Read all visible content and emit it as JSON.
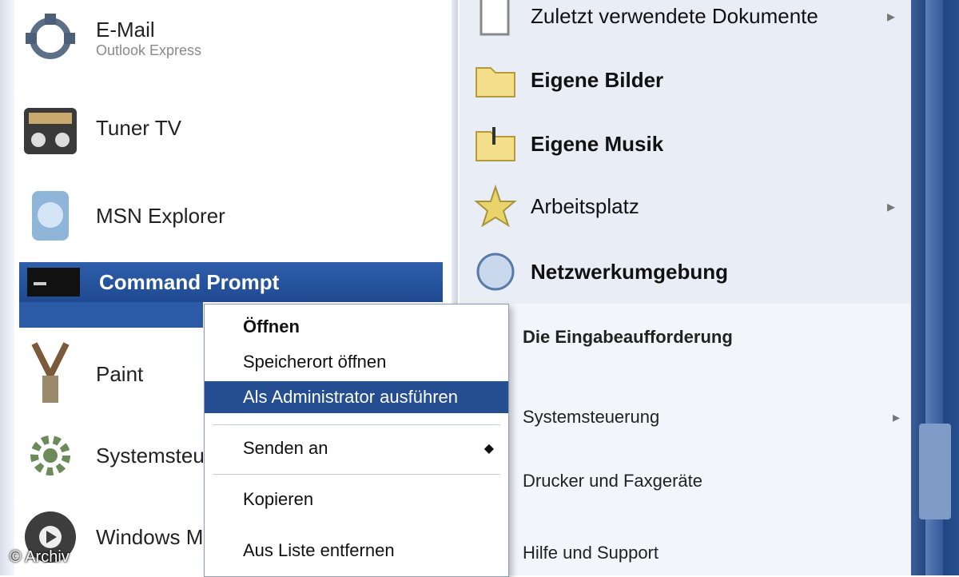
{
  "left_menu": {
    "items": [
      {
        "label": "E-Mail",
        "sub": "Outlook Express"
      },
      {
        "label": "Tuner TV"
      },
      {
        "label": "MSN Explorer"
      },
      {
        "label": "Command Prompt"
      },
      {
        "label": "Paint"
      },
      {
        "label": "Systemsteuerung"
      },
      {
        "label": "Windows Media"
      }
    ]
  },
  "right_menu": {
    "items": [
      {
        "label": "Zuletzt verwendete Dokumente"
      },
      {
        "label": "Eigene Bilder"
      },
      {
        "label": "Eigene Musik"
      },
      {
        "label": "Arbeitsplatz"
      },
      {
        "label": "Netzwerkumgebung"
      }
    ]
  },
  "context_menu": {
    "items": [
      {
        "label": "Öffnen"
      },
      {
        "label": "Speicherort öffnen"
      },
      {
        "label": "Als Administrator ausführen"
      },
      {
        "label": "Senden an"
      },
      {
        "label": "Kopieren"
      },
      {
        "label": "Aus Liste entfernen"
      }
    ]
  },
  "sub_menu": {
    "items": [
      {
        "label": "Die Eingabeaufforderung"
      },
      {
        "label": "Systemsteuerung"
      },
      {
        "label": "Drucker und Faxgeräte"
      },
      {
        "label": "Hilfe und Support"
      }
    ]
  },
  "watermark": "© Archiv",
  "colors": {
    "selection": "#1f4a92",
    "right_pane": "#e9eef6",
    "frame": "#1c3f78"
  }
}
